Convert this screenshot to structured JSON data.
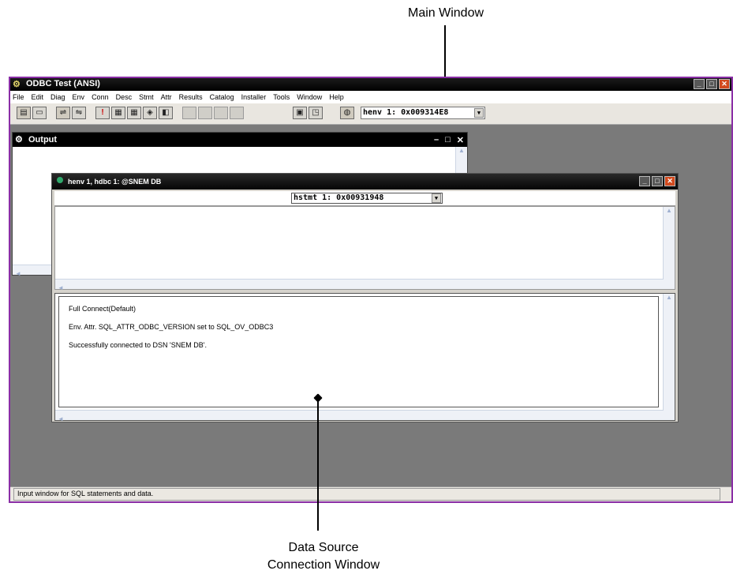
{
  "callouts": {
    "main_window": "Main Window",
    "connection_window_line1": "Data Source",
    "connection_window_line2": "Connection  Window"
  },
  "main_window": {
    "title": "ODBC Test (ANSI)",
    "menu": [
      "File",
      "Edit",
      "Diag",
      "Env",
      "Conn",
      "Desc",
      "Stmt",
      "Attr",
      "Results",
      "Catalog",
      "Installer",
      "Tools",
      "Window",
      "Help"
    ],
    "henv_select": "henv 1: 0x009314E8",
    "statusbar": "Input window for SQL statements and data."
  },
  "output_window": {
    "title": "Output"
  },
  "connection_window": {
    "title": "henv 1, hdbc 1: @SNEM DB",
    "hstmt_select": "hstmt 1: 0x00931948",
    "results": [
      "Full Connect(Default)",
      "Env. Attr. SQL_ATTR_ODBC_VERSION set to SQL_OV_ODBC3",
      "Successfully connected to DSN 'SNEM DB'."
    ]
  },
  "icons": {
    "app": "odbc-plug-icon",
    "minimize": "minimize-icon",
    "maximize": "maximize-icon",
    "close": "close-icon"
  },
  "colors": {
    "main_border": "#8a2ea6",
    "close_button": "#d24a1e",
    "desktop": "#7a7a7a"
  }
}
